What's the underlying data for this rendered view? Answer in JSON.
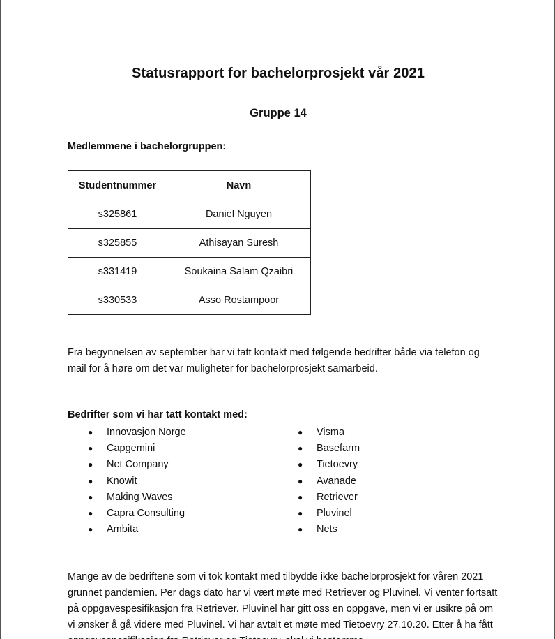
{
  "document": {
    "title": "Statusrapport for bachelorprosjekt vår 2021",
    "group": "Gruppe 14",
    "members_heading": "Medlemmene i bachelorgruppen:",
    "table": {
      "headers": [
        "Studentnummer",
        "Navn"
      ],
      "rows": [
        [
          "s325861",
          "Daniel Nguyen"
        ],
        [
          "s325855",
          "Athisayan Suresh"
        ],
        [
          "s331419",
          "Soukaina Salam Qzaibri"
        ],
        [
          "s330533",
          "Asso Rostampoor"
        ]
      ]
    },
    "intro_paragraph": "Fra begynnelsen av september har vi tatt kontakt med følgende bedrifter både via telefon og mail for å høre om det var muligheter for bachelorprosjekt samarbeid.",
    "companies_heading": "Bedrifter som vi har tatt kontakt med:",
    "companies_left": [
      "Innovasjon Norge",
      "Capgemini",
      "Net Company",
      "Knowit",
      "Making Waves",
      "Capra Consulting",
      "Ambita"
    ],
    "companies_right": [
      "Visma",
      "Basefarm",
      "Tietoevry",
      "Avanade",
      "Retriever",
      "Pluvinel",
      "Nets"
    ],
    "bullet_glyph": "●",
    "status_paragraph": "Mange av de bedriftene som vi tok kontakt med tilbydde ikke bachelorprosjekt for våren 2021 grunnet pandemien. Per dags dato har vi vært møte med Retriever og Pluvinel. Vi venter fortsatt på oppgavespesifikasjon fra Retriever. Pluvinel har gitt oss en oppgave, men vi er usikre på om vi ønsker å gå videre med Pluvinel. Vi har avtalt et møte med Tietoevry 27.10.20. Etter å ha fått oppgavespesifikasjon fra Retriever og Tietoevry, skal vi bestemme"
  }
}
